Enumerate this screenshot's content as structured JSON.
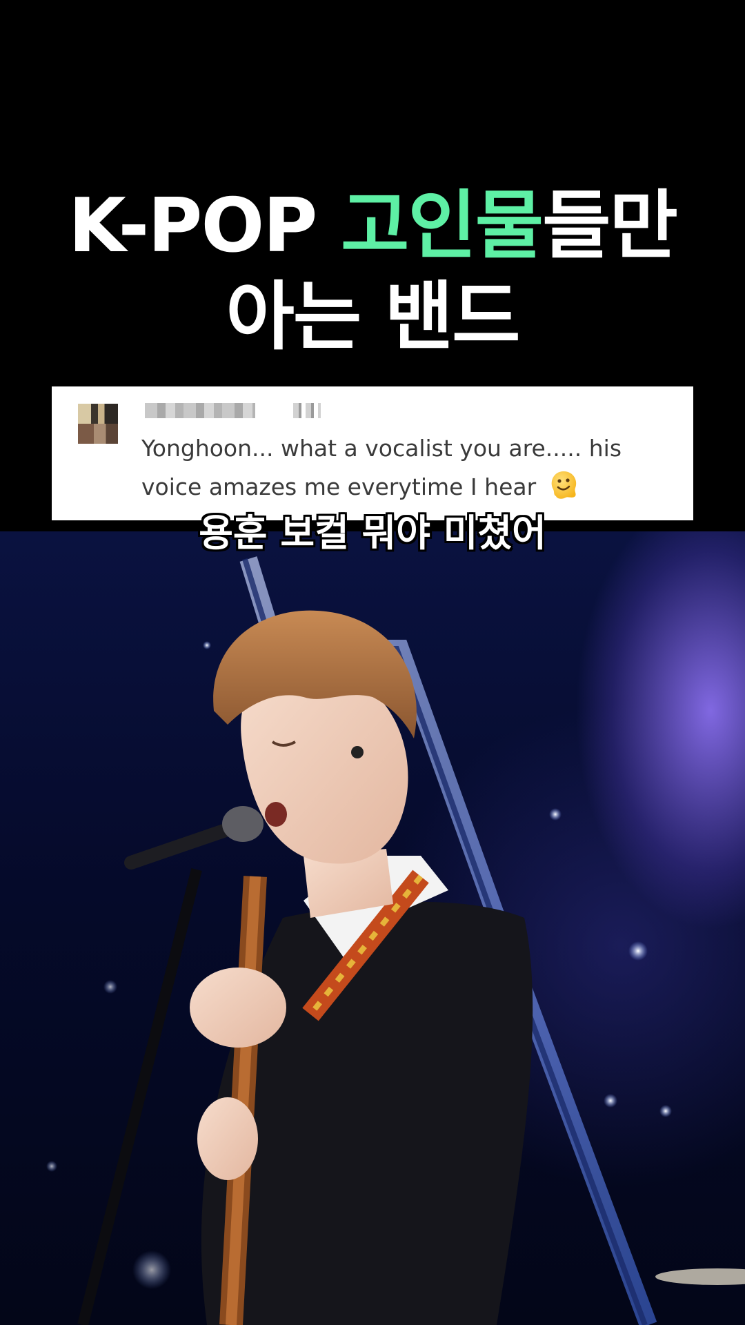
{
  "title": {
    "line1_prefix": "K-POP ",
    "line1_accent": "고인물",
    "line1_suffix": "들만",
    "line2": "아는 밴드",
    "accent_color": "#5ef0a5"
  },
  "comment": {
    "text": "Yonghoon... what a vocalist you are..... his voice amazes me everytime I hear",
    "emoji": "melting-face-emoji"
  },
  "subtitle": "용훈 보컬 뭐야 미쳤어"
}
